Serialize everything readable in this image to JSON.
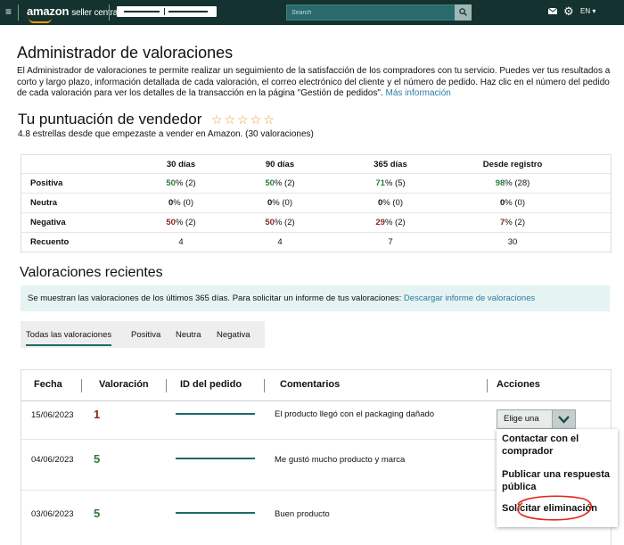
{
  "topbar": {
    "logo": "amazon",
    "logo_sub": "seller central",
    "search_placeholder": "Search",
    "lang": "EN"
  },
  "page_title": "Administrador de valoraciones",
  "intro_text": "El Administrador de valoraciones te permite realizar un seguimiento de la satisfacción de los compradores con tu servicio. Puedes ver tus resultados a corto y largo plazo, información detallada de cada valoración, el correo electrónico del cliente y el número de pedido. Haz clic en el número del pedido de cada valoración para ver los detalles de la transacción en la página \"Gestión de pedidos\".",
  "intro_link": "Más información",
  "score": {
    "title": "Tu puntuación de vendedor",
    "stars": "☆☆☆☆☆",
    "subtitle": "4.8 estrellas desde que empezaste a vender en Amazon. (30 valoraciones)"
  },
  "stats": {
    "headers": [
      "30 días",
      "90 días",
      "365 días",
      "Desde registro"
    ],
    "positiva": {
      "label": "Positiva",
      "values": [
        [
          "50",
          "% (2)"
        ],
        [
          "50",
          "% (2)"
        ],
        [
          "71",
          "% (5)"
        ],
        [
          "98",
          "% (28)"
        ]
      ]
    },
    "neutra": {
      "label": "Neutra",
      "values": [
        [
          "0",
          "% (0)"
        ],
        [
          "0",
          "% (0)"
        ],
        [
          "0",
          "% (0)"
        ],
        [
          "0",
          "% (0)"
        ]
      ]
    },
    "negativa": {
      "label": "Negativa",
      "values": [
        [
          "50",
          "% (2)"
        ],
        [
          "50",
          "% (2)"
        ],
        [
          "29",
          "% (2)"
        ],
        [
          "7",
          "% (2)"
        ]
      ]
    },
    "recuento": {
      "label": "Recuento",
      "values": [
        "4",
        "4",
        "7",
        "30"
      ]
    }
  },
  "recent": {
    "title": "Valoraciones recientes",
    "banner_text": "Se muestran las valoraciones de los últimos 365 días. Para solicitar un informe de tus valoraciones:",
    "banner_link": "Descargar informe de valoraciones",
    "tabs": [
      "Todas las valoraciones",
      "Positiva",
      "Neutra",
      "Negativa"
    ]
  },
  "table": {
    "headers": {
      "fecha": "Fecha",
      "valoracion": "Valoración",
      "pedido": "ID del pedido",
      "comentarios": "Comentarios",
      "acciones": "Acciones"
    },
    "rows": [
      {
        "date": "15/06/2023",
        "rating": "1",
        "comment": "El producto llegó con el packaging dañado"
      },
      {
        "date": "04/06/2023",
        "rating": "5",
        "comment": "Me gustó mucho producto y marca"
      },
      {
        "date": "03/06/2023",
        "rating": "5",
        "comment": "Buen producto"
      }
    ],
    "action_select": "Elige una",
    "menu": [
      "Contactar con el comprador",
      "Publicar una respuesta pública",
      "Solicitar eliminación"
    ]
  },
  "colors": {
    "topbar": "#14322f",
    "positive": "#2c7a3c",
    "negative": "#8a2a1e",
    "link": "#2a7ba6",
    "banner": "#e5f3f2",
    "highlight_circle": "#e0261b"
  }
}
